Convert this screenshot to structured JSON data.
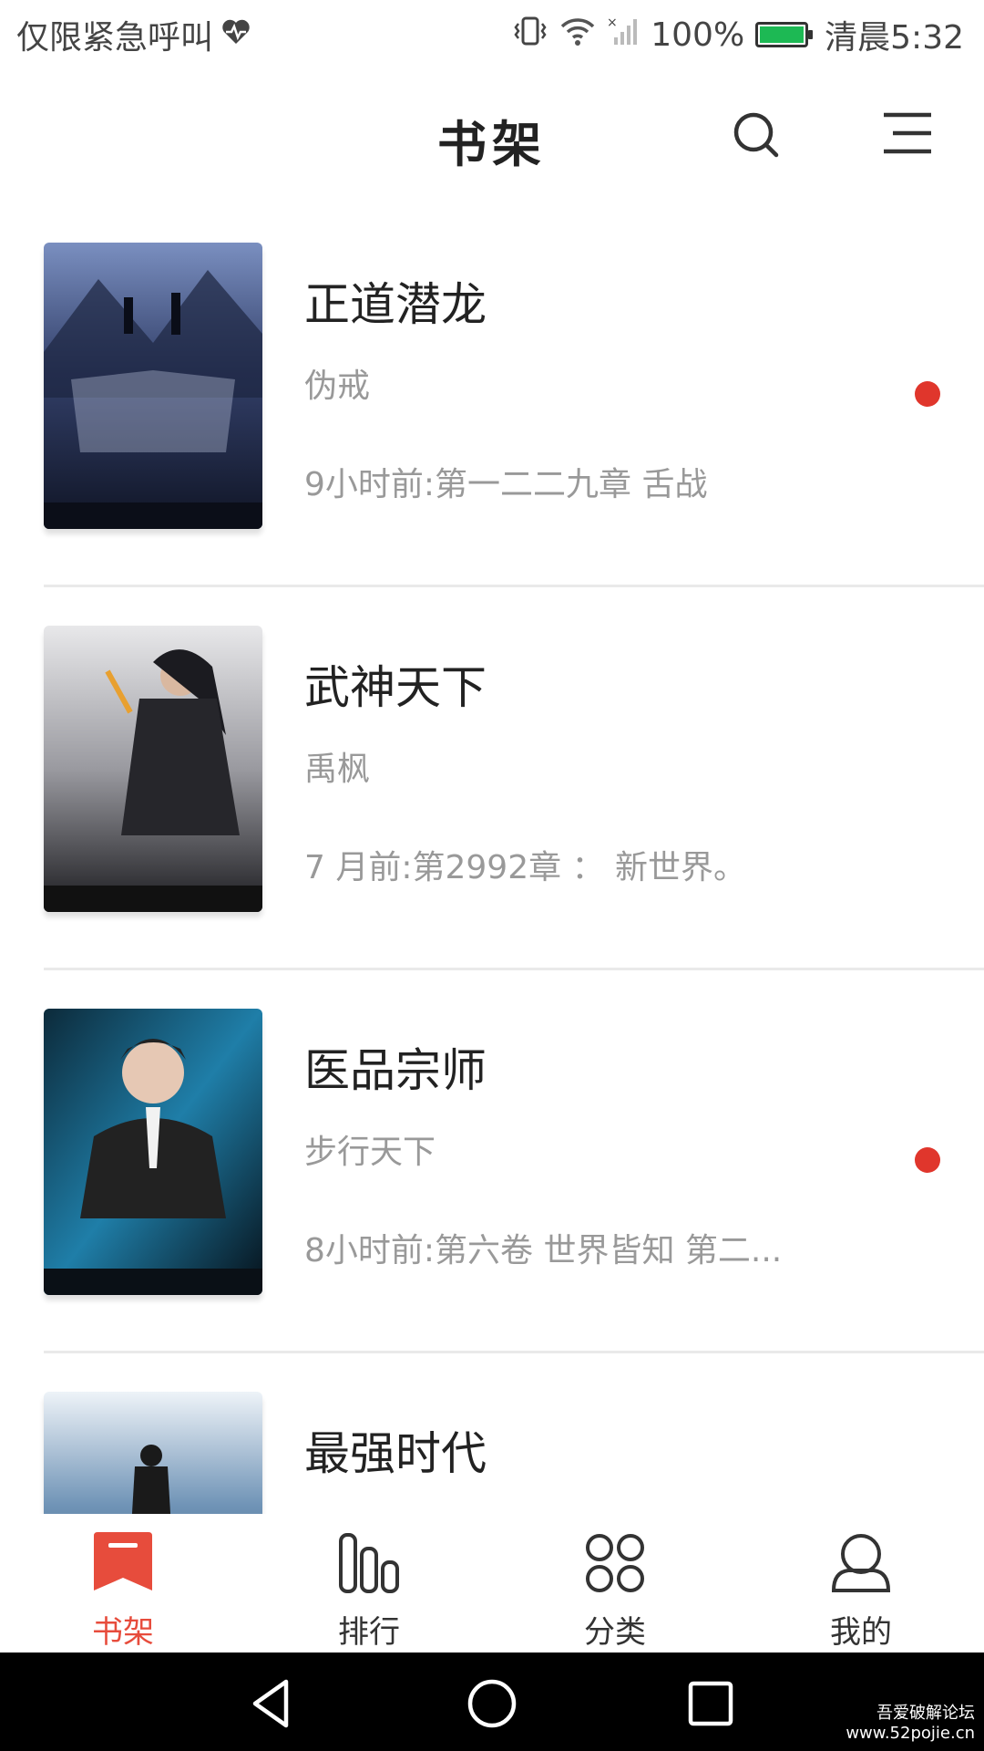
{
  "status_bar": {
    "emergency_text": "仅限紧急呼叫",
    "battery": "100%",
    "time": "清晨5:32"
  },
  "header": {
    "title": "书架"
  },
  "books": [
    {
      "title": "正道潜龙",
      "author": "伪戒",
      "latest": "9小时前:第一二二九章 舌战",
      "has_update": true
    },
    {
      "title": "武神天下",
      "author": "禹枫",
      "latest": "7 月前:第2992章 ： 新世界。",
      "has_update": false
    },
    {
      "title": "医品宗师",
      "author": "步行天下",
      "latest": "8小时前:第六卷 世界皆知 第二...",
      "has_update": true
    },
    {
      "title": "最强时代",
      "author": "",
      "latest": "",
      "has_update": false
    }
  ],
  "tabs": [
    {
      "label": "书架",
      "icon": "bookshelf-icon",
      "active": true
    },
    {
      "label": "排行",
      "icon": "ranking-icon",
      "active": false
    },
    {
      "label": "分类",
      "icon": "category-icon",
      "active": false
    },
    {
      "label": "我的",
      "icon": "profile-icon",
      "active": false
    }
  ],
  "watermark": {
    "line1": "吾爱破解论坛",
    "line2": "www.52pojie.cn"
  },
  "colors": {
    "accent": "#e74c3c",
    "update_dot": "#e0362c",
    "battery_fill": "#1db954"
  }
}
